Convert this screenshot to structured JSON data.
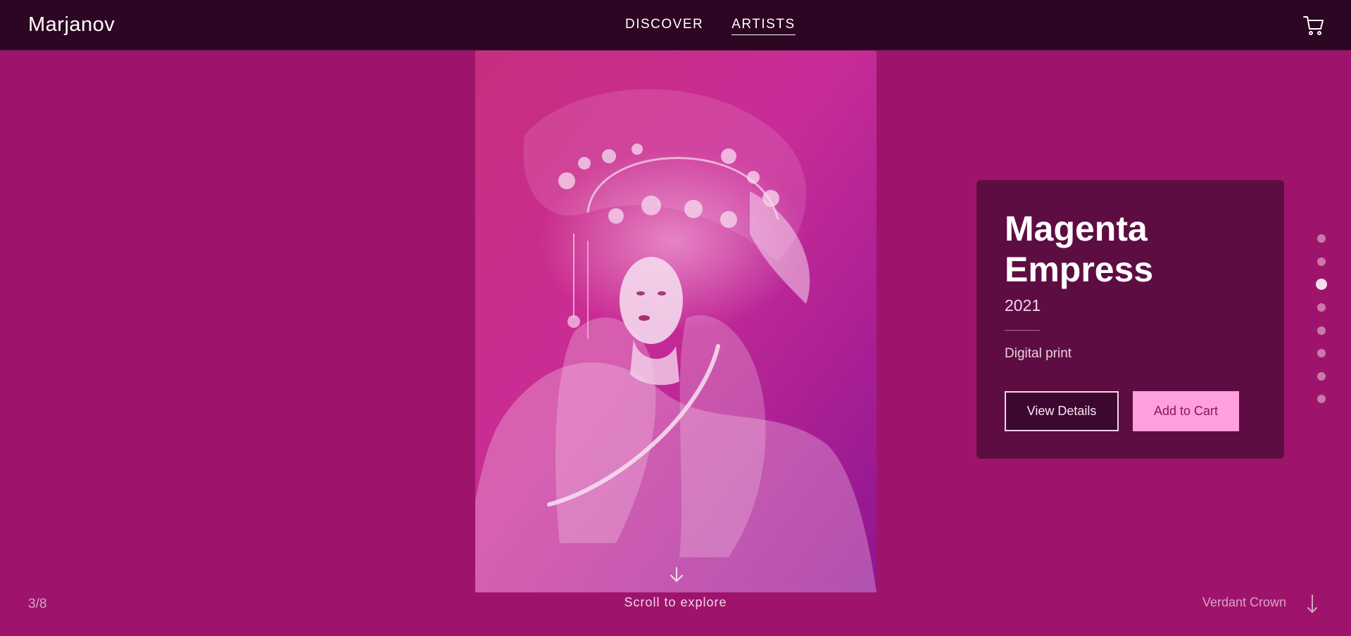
{
  "header": {
    "logo": "Marjanov",
    "nav": [
      {
        "label": "DISCOVER",
        "active": false
      },
      {
        "label": "ARTISTS",
        "active": true
      }
    ],
    "cart_icon": "cart-icon"
  },
  "artwork": {
    "image_icon": "portrait-artwork-image",
    "palette": {
      "background": "#9e146c",
      "accent": "#ff9fdd",
      "card": "#5e0d42",
      "header": "#2c0622"
    }
  },
  "info_card": {
    "title_line1": "Magenta",
    "title_line2": "Empress",
    "year": "2021",
    "medium": "Digital print",
    "view_details_label": "View Details",
    "add_to_cart_label": "Add to Cart"
  },
  "pagination": {
    "current": 3,
    "total": 8,
    "counter_text": "3/8"
  },
  "footer": {
    "scroll_text": "Scroll to explore",
    "next_title": "Verdant Crown",
    "scroll_icon": "arrow-down-icon",
    "next_icon": "arrow-down-long-icon"
  }
}
